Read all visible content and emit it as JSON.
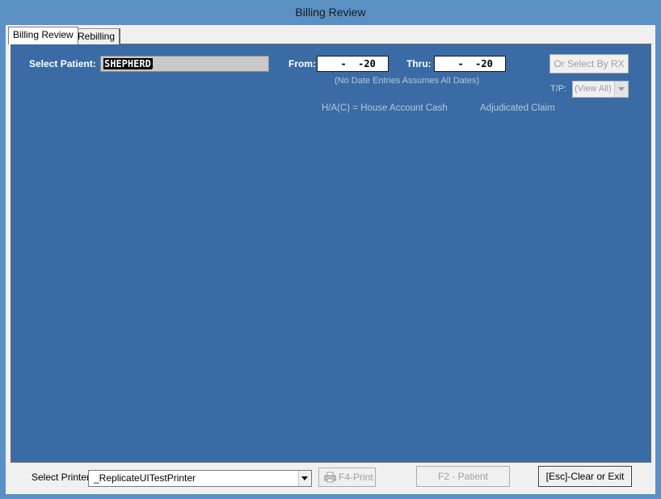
{
  "window": {
    "title": "Billing Review"
  },
  "tabs": [
    {
      "label": "Billing Review",
      "selected": true
    },
    {
      "label": "Rebilling",
      "selected": false
    }
  ],
  "patient": {
    "label": "Select Patient:",
    "value": "SHEPHERD"
  },
  "dates": {
    "from_label": "From:",
    "from_value": "  -  -20",
    "thru_label": "Thru:",
    "thru_value": "  -  -20",
    "note": "(No Date Entries Assumes All Dates)"
  },
  "rx_button": {
    "label": "Or Select By RX",
    "enabled": false
  },
  "tp": {
    "label": "T/P:",
    "value": "(View All)",
    "enabled": false
  },
  "legend": {
    "house_account": "H/A(C) = House Account Cash",
    "adjudicated": "Adjudicated Claim"
  },
  "footer": {
    "printer_label": "Select Printer:",
    "printer_value": "_ReplicateUITestPrinter",
    "print_button": "F4-Print",
    "patient_button": "F2 - Patient",
    "clear_button": "[Esc]-Clear or Exit"
  },
  "colors": {
    "panel_bg": "#3a6ba5",
    "titlebar_bg": "#5b90c5",
    "window_bg": "#f0f0f0",
    "disabled_text": "#a0a0a0"
  }
}
